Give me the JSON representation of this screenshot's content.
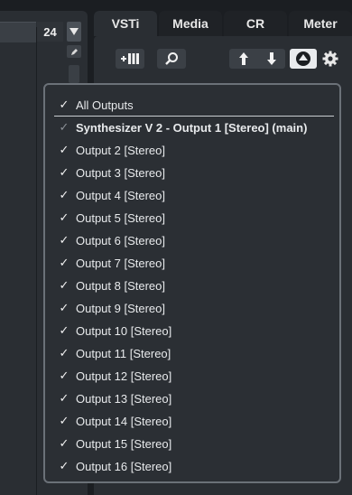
{
  "left": {
    "value": "24"
  },
  "tabs": [
    {
      "label": "VSTi",
      "active": true
    },
    {
      "label": "Media",
      "active": false
    },
    {
      "label": "CR",
      "active": false
    },
    {
      "label": "Meter",
      "active": false
    }
  ],
  "toolbar": {
    "icons": [
      "add-instrument-icon",
      "search-icon",
      "arrow-up-icon",
      "arrow-down-icon",
      "output-routing-icon",
      "gear-icon"
    ]
  },
  "menu": {
    "all_outputs": "All Outputs",
    "items": [
      {
        "label": "Synthesizer V 2 - Output 1 [Stereo] (main)",
        "checked": true
      },
      {
        "label": "Output 2 [Stereo]",
        "checked": true
      },
      {
        "label": "Output 3 [Stereo]",
        "checked": true
      },
      {
        "label": "Output 4 [Stereo]",
        "checked": true
      },
      {
        "label": "Output 5 [Stereo]",
        "checked": true
      },
      {
        "label": "Output 6 [Stereo]",
        "checked": true
      },
      {
        "label": "Output 7 [Stereo]",
        "checked": true
      },
      {
        "label": "Output 8 [Stereo]",
        "checked": true
      },
      {
        "label": "Output 9 [Stereo]",
        "checked": true
      },
      {
        "label": "Output 10 [Stereo]",
        "checked": true
      },
      {
        "label": "Output 11 [Stereo]",
        "checked": true
      },
      {
        "label": "Output 12 [Stereo]",
        "checked": true
      },
      {
        "label": "Output 13 [Stereo]",
        "checked": true
      },
      {
        "label": "Output 14 [Stereo]",
        "checked": true
      },
      {
        "label": "Output 15 [Stereo]",
        "checked": true
      },
      {
        "label": "Output 16 [Stereo]",
        "checked": true
      }
    ],
    "check_glyph": "✓"
  },
  "colors": {
    "background": "#1b1e22",
    "panel": "#2a2e33",
    "menu_border": "#6b7178",
    "button_light": "#e9ebee"
  }
}
